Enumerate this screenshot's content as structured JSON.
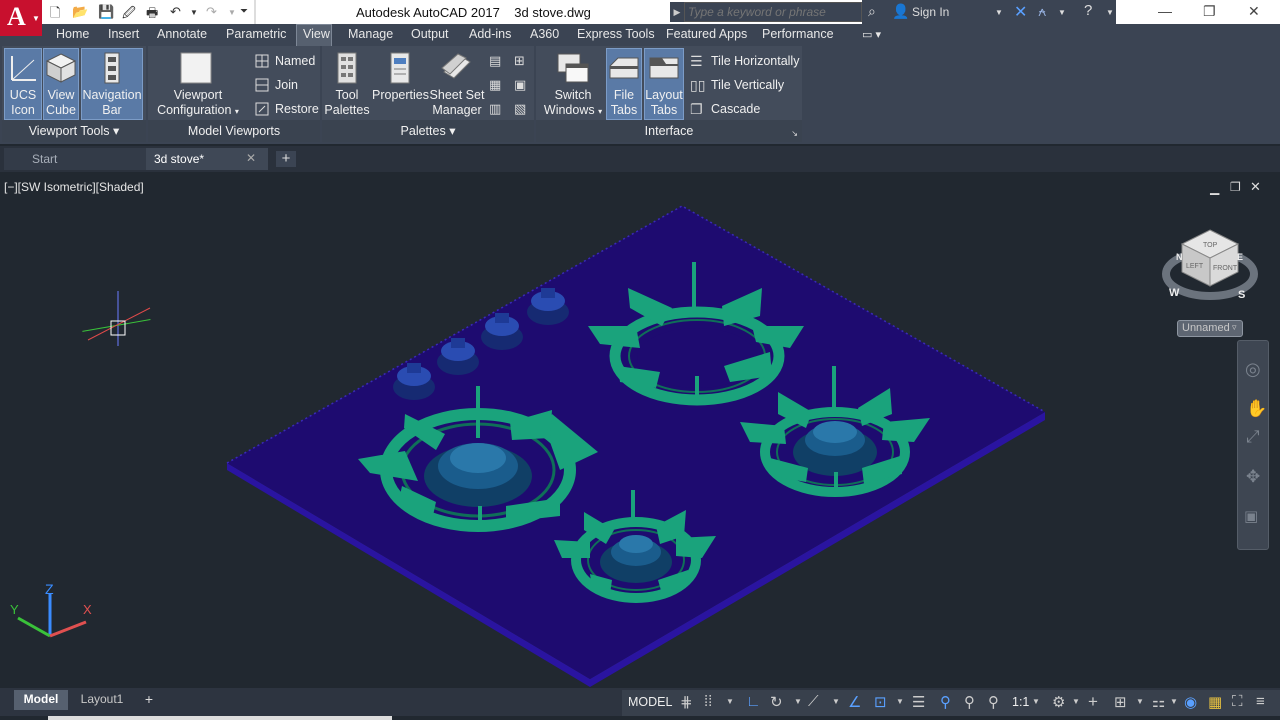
{
  "title_bar": {
    "title": "Autodesk AutoCAD 2017    3d stove.dwg",
    "search_placeholder": "Type a keyword or phrase",
    "sign_in": "Sign In",
    "app_letter": "A"
  },
  "ribbon_tabs": [
    "Home",
    "Insert",
    "Annotate",
    "Parametric",
    "View",
    "Manage",
    "Output",
    "Add-ins",
    "A360",
    "Express Tools",
    "Featured Apps",
    "Performance"
  ],
  "ribbon": {
    "viewport_tools": {
      "title": "Viewport Tools",
      "ucs_icon": [
        "UCS",
        "Icon"
      ],
      "view_cube": [
        "View",
        "Cube"
      ],
      "navigation_bar": [
        "Navigation",
        "Bar"
      ]
    },
    "model_viewports": {
      "title": "Model Viewports",
      "viewport_configuration": [
        "Viewport",
        "Configuration"
      ],
      "named": "Named",
      "join": "Join",
      "restore": "Restore"
    },
    "palettes": {
      "title": "Palettes",
      "tool_palettes": [
        "Tool",
        "Palettes"
      ],
      "properties": "Properties",
      "sheet_set_manager": [
        "Sheet Set",
        "Manager"
      ]
    },
    "interface": {
      "title": "Interface",
      "switch_windows": [
        "Switch",
        "Windows"
      ],
      "file_tabs": [
        "File",
        "Tabs"
      ],
      "layout_tabs": [
        "Layout",
        "Tabs"
      ],
      "tile_horizontally": "Tile Horizontally",
      "tile_vertically": "Tile Vertically",
      "cascade": "Cascade"
    }
  },
  "file_tabs": {
    "start": "Start",
    "drawing": "3d stove*"
  },
  "viewport": {
    "label": "[−][SW Isometric][Shaded]",
    "view_cube_faces": {
      "top": "TOP",
      "left": "LEFT",
      "front": "FRONT"
    },
    "compass": {
      "w": "W",
      "s": "S",
      "n": "N",
      "e": "E"
    },
    "ucs_name": "Unnamed",
    "axis_labels": {
      "x": "X",
      "y": "Y",
      "z": "Z"
    }
  },
  "layout_tabs": {
    "model": "Model",
    "layout1": "Layout1"
  },
  "status_bar": {
    "model": "MODEL",
    "scale": "1:1"
  },
  "colors": {
    "plate": "#1e0b70",
    "plate_edge": "#2a14a0",
    "grate": "#1aa37c",
    "burner": "#1a5c8c",
    "knob": "#1e3a96",
    "accent_blue": "#5a7aa6",
    "logo_red": "#c8102e"
  }
}
